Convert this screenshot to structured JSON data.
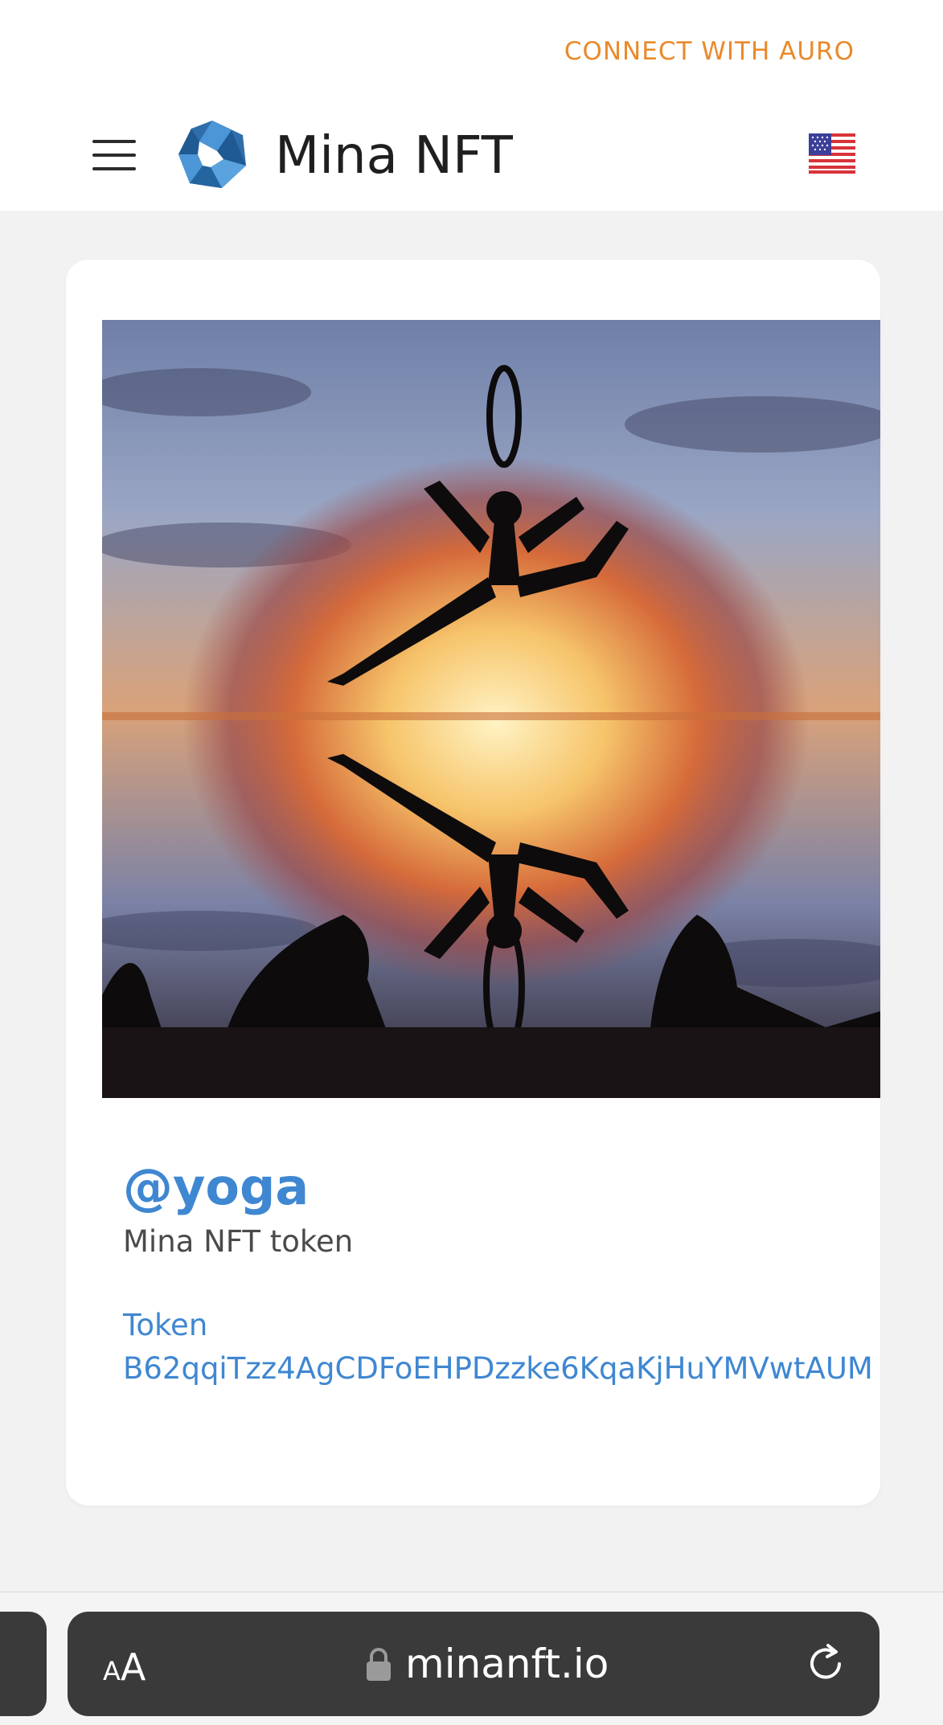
{
  "header": {
    "connect_label": "CONNECT WITH AURO",
    "brand_name": "Mina NFT",
    "menu_icon": "hamburger-menu-icon",
    "logo_icon": "mina-nft-logo",
    "language_icon": "us-flag-icon"
  },
  "nft": {
    "image_description": "yoga-silhouette-artwork",
    "handle": "@yoga",
    "subtitle": "Mina NFT token",
    "token_label": "Token",
    "token_address": "B62qqiTzz4AgCDFoEHPDzzke6KqaKjHuYMVwtAUM"
  },
  "browser": {
    "text_size_label": "AA",
    "url": "minanft.io",
    "lock_icon": "lock-icon",
    "reload_icon": "reload-icon"
  },
  "colors": {
    "accent_orange": "#e98a2b",
    "link_blue": "#3f87d1",
    "page_bg": "#f2f2f2"
  }
}
